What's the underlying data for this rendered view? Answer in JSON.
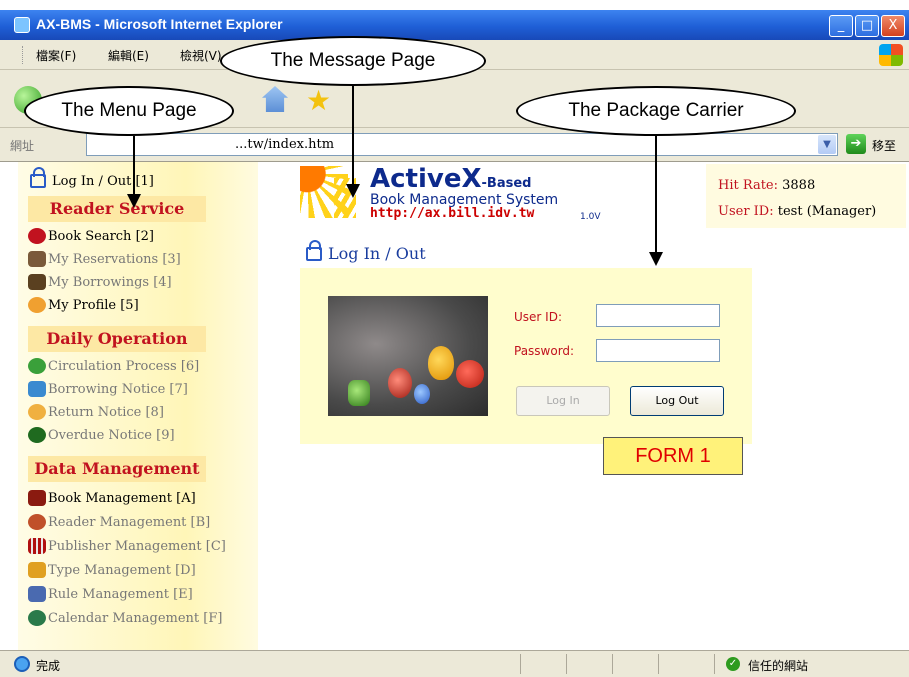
{
  "window": {
    "title": "AX-BMS - Microsoft Internet Explorer",
    "minimize": "_",
    "maximize": "□",
    "close": "X"
  },
  "menubar": {
    "items": [
      "檔案(F)",
      "編輯(E)",
      "檢視(V)"
    ]
  },
  "address": {
    "label": "網址",
    "value": "...tw/index.htm",
    "go_label": "移至"
  },
  "menu_page": {
    "login_link": "Log In / Out [1]",
    "sections": [
      {
        "title": "Reader Service",
        "items": [
          "Book Search [2]",
          "My Reservations [3]",
          "My Borrowings [4]",
          "My Profile [5]"
        ]
      },
      {
        "title": "Daily Operation",
        "items": [
          "Circulation Process [6]",
          "Borrowing Notice [7]",
          "Return Notice [8]",
          "Overdue Notice [9]"
        ]
      },
      {
        "title": "Data Management",
        "items": [
          "Book Management [A]",
          "Reader Management [B]",
          "Publisher Management [C]",
          "Type Management [D]",
          "Rule Management [E]",
          "Calendar Management [F]"
        ]
      }
    ]
  },
  "logo": {
    "title": "ActiveX",
    "title_suffix": "-Based",
    "subtitle": "Book Management System",
    "url": "http://ax.bill.idv.tw",
    "version": "1.0V"
  },
  "stats": {
    "hit_rate_label": "Hit Rate:",
    "hit_rate_value": "3888",
    "user_id_label": "User ID:",
    "user_id_value": "test (Manager)"
  },
  "login_form": {
    "heading": "Log In / Out",
    "user_id_label": "User ID:",
    "user_id_value": "",
    "password_label": "Password:",
    "password_value": "",
    "login_button": "Log In",
    "logout_button": "Log Out",
    "tag": "FORM 1"
  },
  "statusbar": {
    "text": "完成",
    "zone": "信任的網站"
  },
  "callouts": {
    "menu_page": "The Menu Page",
    "message_page": "The Message Page",
    "package_carrier": "The Package Carrier"
  }
}
